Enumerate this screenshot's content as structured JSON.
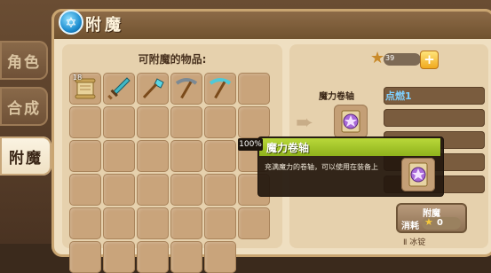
{
  "window": {
    "title": "附魔"
  },
  "tabs": [
    {
      "label": "角色",
      "active": false
    },
    {
      "label": "合成",
      "active": false
    },
    {
      "label": "附魔",
      "active": true
    }
  ],
  "inventory": {
    "title": "可附魔的物品:",
    "items": [
      {
        "name": "scroll-icon",
        "count": "18"
      },
      {
        "name": "sword-icon",
        "count": ""
      },
      {
        "name": "shovel-icon",
        "count": ""
      },
      {
        "name": "pickaxe-icon",
        "count": ""
      },
      {
        "name": "pickaxe-icon",
        "count": ""
      }
    ]
  },
  "currency": {
    "value": "39",
    "plus": "+"
  },
  "enchant_panel": {
    "scroll_label": "魔力卷轴",
    "enchantments": [
      "点燃1",
      "",
      "",
      "",
      ""
    ],
    "button_label": "附魔",
    "cost_label": "消耗",
    "cost_value": "0",
    "bottom_text": "Ⅱ 冰锭"
  },
  "tooltip": {
    "percent": "100%",
    "title": "魔力卷轴",
    "description": "充满魔力的卷轴，可以使用在装备上"
  },
  "colors": {
    "accent": "#8fb21c",
    "panel": "#efdfc1",
    "enchant_text": "#7fd0ff"
  }
}
